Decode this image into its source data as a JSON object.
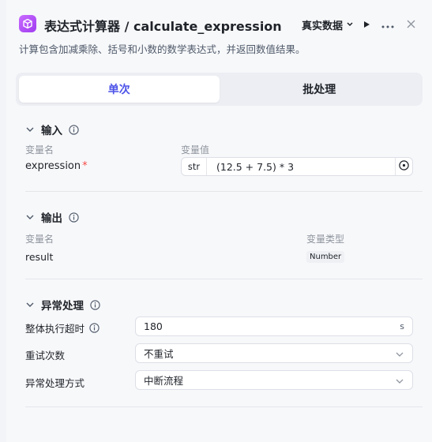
{
  "header": {
    "title": "表达式计算器 / calculate_expression",
    "data_mode": "真实数据",
    "description": "计算包含加减乘除、括号和小数的数学表达式，并返回数值结果。"
  },
  "tabs": [
    {
      "label": "单次",
      "active": true
    },
    {
      "label": "批处理",
      "active": false
    }
  ],
  "input_section": {
    "title": "输入",
    "col_name": "变量名",
    "col_value": "变量值",
    "params": [
      {
        "name": "expression",
        "required": "*",
        "type": "str",
        "value": "(12.5 + 7.5) * 3"
      }
    ]
  },
  "output_section": {
    "title": "输出",
    "col_name": "变量名",
    "col_type": "变量类型",
    "params": [
      {
        "name": "result",
        "type": "Number"
      }
    ]
  },
  "error_section": {
    "title": "异常处理",
    "timeout": {
      "label": "整体执行超时",
      "value": "180",
      "unit": "s"
    },
    "retry": {
      "label": "重试次数",
      "value": "不重试"
    },
    "handling": {
      "label": "异常处理方式",
      "value": "中断流程"
    }
  },
  "colors": {
    "accent": "#4d53e8",
    "icon": "#b44cf5",
    "required": "#f54a45"
  }
}
